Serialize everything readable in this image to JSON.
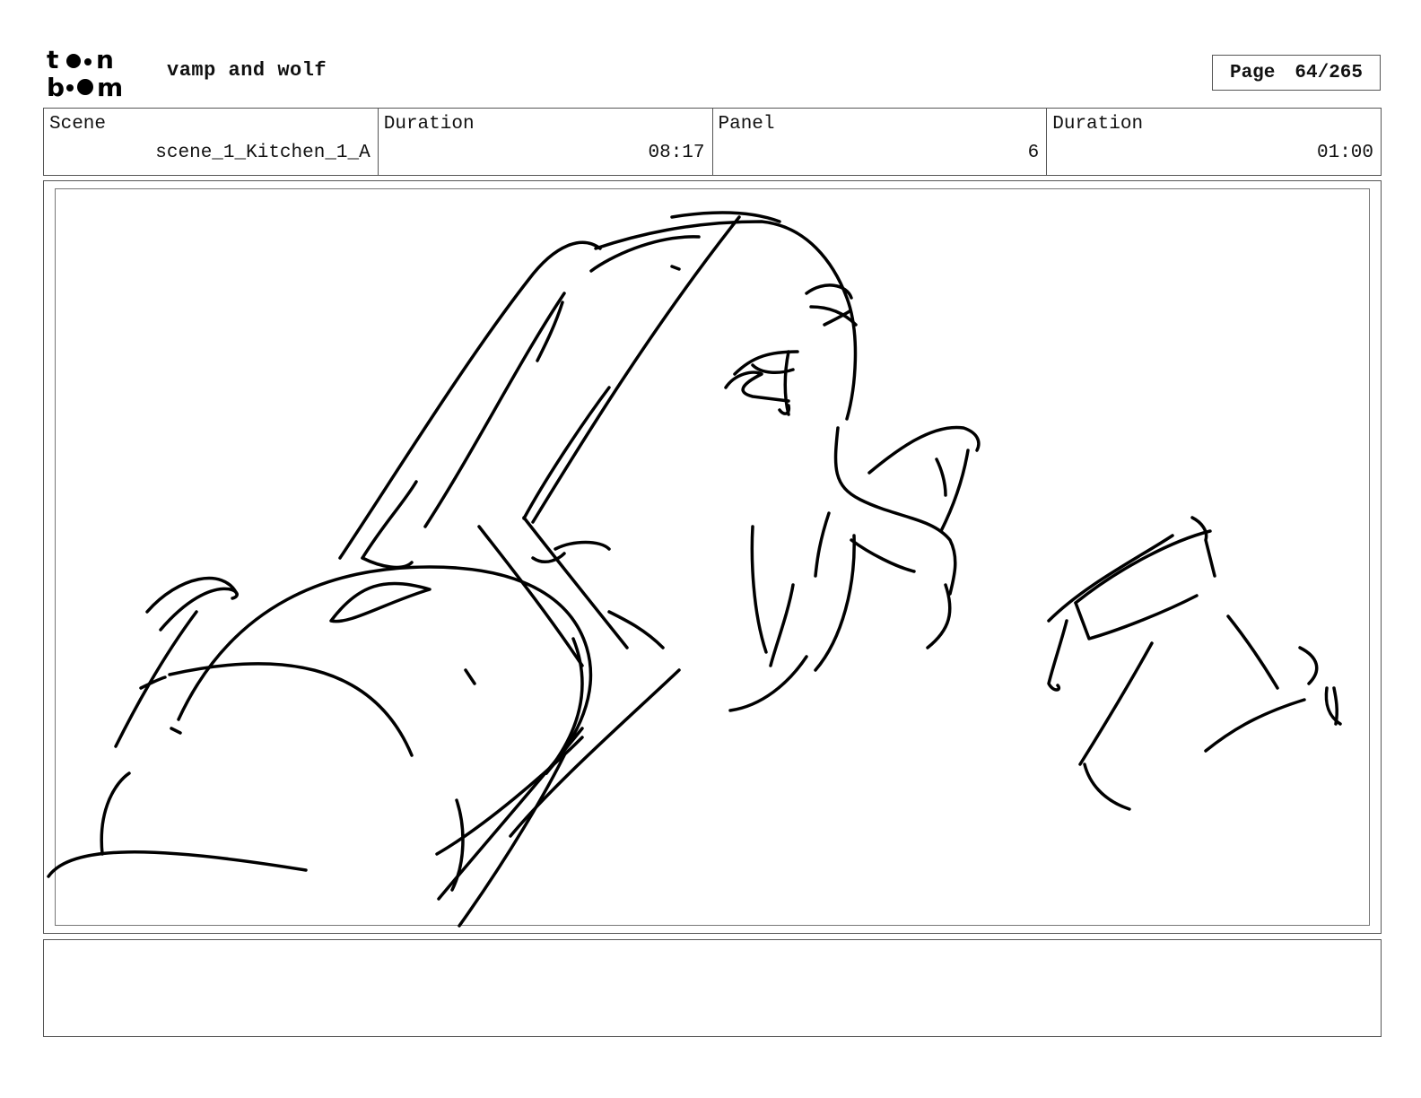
{
  "header": {
    "logo_alt": "toon boom",
    "project_title": "vamp and wolf",
    "page_label": "Page",
    "page_number": "64/265"
  },
  "info": {
    "scene_label": "Scene",
    "scene_value": "scene_1_Kitchen_1_A",
    "scene_duration_label": "Duration",
    "scene_duration_value": "08:17",
    "panel_label": "Panel",
    "panel_value": "6",
    "panel_duration_label": "Duration",
    "panel_duration_value": "01:00"
  },
  "panel": {
    "image": "rough sketch drawing",
    "stroke_color": "#000000"
  },
  "notes": {
    "text": ""
  }
}
